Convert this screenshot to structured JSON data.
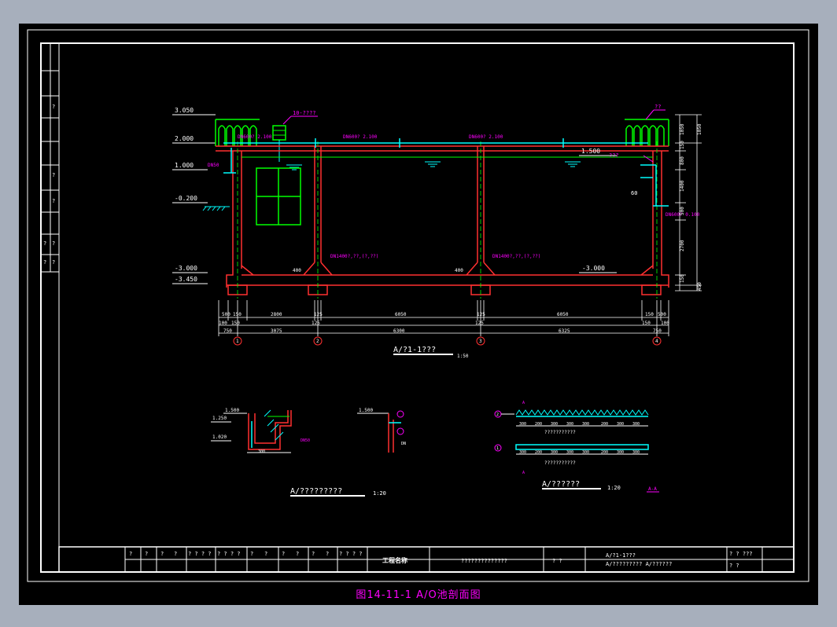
{
  "caption": "图14-11-1  A/O池剖面图",
  "main_title": "A/?1-1???",
  "main_scale": "1:50",
  "detail1_title": "A/?????????",
  "detail1_scale": "1:20",
  "detail2_title": "A/??????",
  "detail2_scale": "1:20",
  "detail_label": "A-A",
  "elevations": {
    "e3050": "3.050",
    "e2000": "2.000",
    "e1000": "1.000",
    "em200": "-0.200",
    "em3000": "-3.000",
    "em3450": "-3.450",
    "e1500": "1.500",
    "em3000r": "-3.000"
  },
  "pipe_labels": {
    "p1": "DN600? 2.100",
    "p2": "DN600? 2.100",
    "p3": "DN600? 2.100",
    "air1": "DN50",
    "inlet": "DN600? 0.100",
    "sludge1": "DN1400?,??,(?,??)",
    "sludge2": "DN1400?,??,(?,??)",
    "l60": "60",
    "l400a": "400",
    "l400b": "400"
  },
  "tags": {
    "motor": "10-????",
    "railing": "??",
    "outlet": "???"
  },
  "dims_row1": [
    "500",
    "150",
    "2800",
    "125",
    "6050",
    "125",
    "6050",
    "150",
    "500"
  ],
  "dims_row2": [
    "100",
    "150",
    "125",
    "125",
    "150",
    "100"
  ],
  "dims_row3": [
    "750",
    "3075",
    "6300",
    "6325",
    "750"
  ],
  "axis_labels": [
    "1",
    "2",
    "3",
    "4"
  ],
  "right_dims": [
    "1050",
    "150",
    "800",
    "1400",
    "500",
    "2700",
    "150",
    "450",
    "1050"
  ],
  "detail2_dims": [
    "300",
    "200",
    "300",
    "300",
    "300",
    "200",
    "300",
    "300"
  ],
  "detail2_note": "???????????",
  "detail2_callouts": [
    "2",
    "1"
  ],
  "left_strip": [
    "?",
    "?",
    "?",
    "?",
    "?",
    "?",
    "?",
    "?"
  ],
  "title_block": {
    "cells_top": [
      "?",
      "?",
      "?",
      "?",
      "? ? ? ?",
      "? ? ? ?",
      "?",
      "?",
      "?",
      "?",
      "?",
      "?",
      "? ? ? ?"
    ],
    "project_label": "工程名称",
    "project_name": "??????????????",
    "stage": "?  ?",
    "drawing_title1": "A/?1-1???",
    "drawing_title2": "A/????????? A/??????",
    "right1": "?   ?   ???",
    "right2": "?   ?"
  }
}
